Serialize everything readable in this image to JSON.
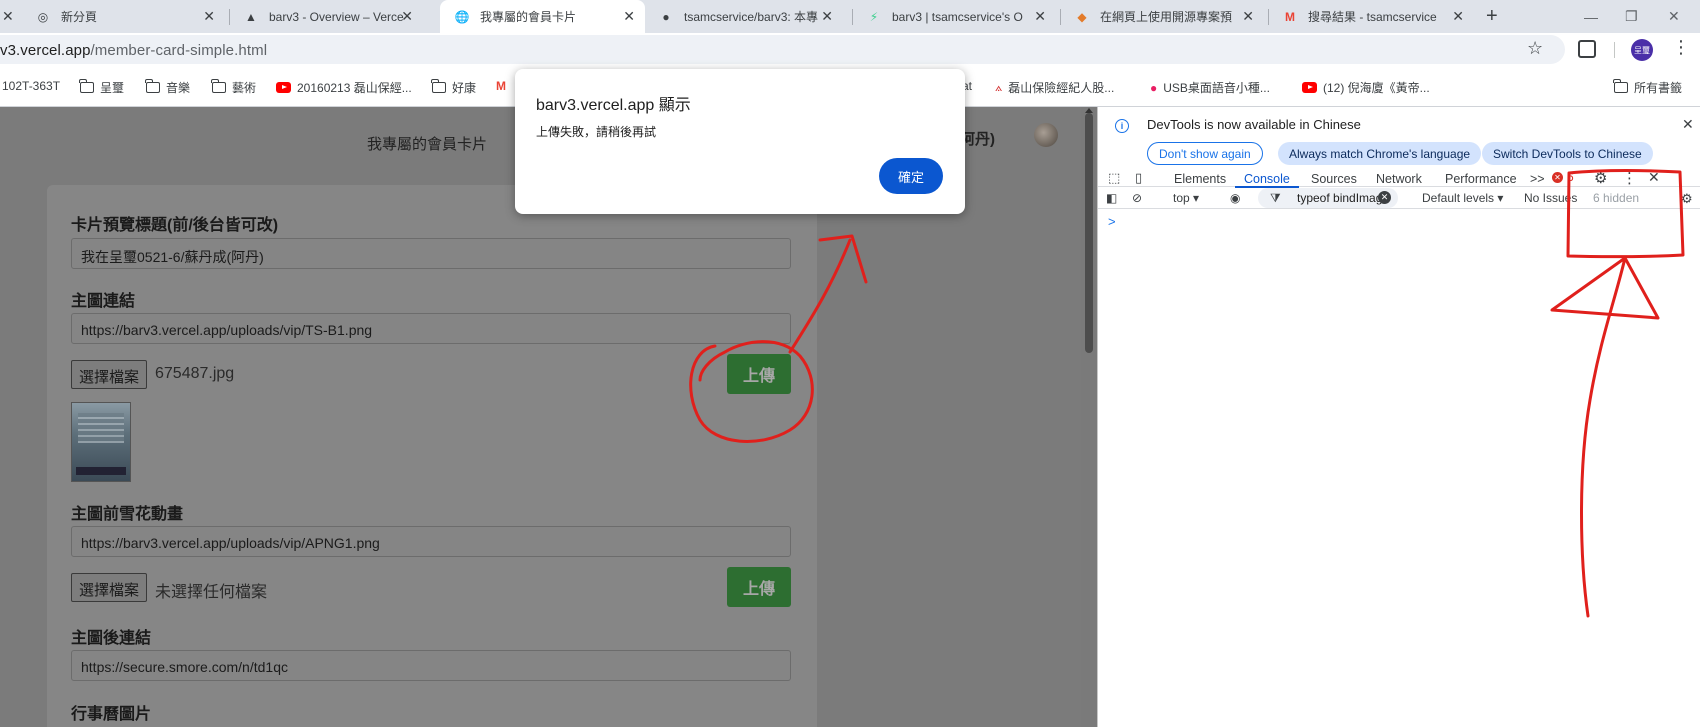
{
  "browser": {
    "tabs": [
      {
        "title": "新分頁",
        "icon": "chrome-icon"
      },
      {
        "title": "barv3 - Overview – Verce",
        "icon": "vercel-icon"
      },
      {
        "title": "我專屬的會員卡片",
        "icon": "globe-icon"
      },
      {
        "title": "tsamcservice/barv3: 本專",
        "icon": "github-icon"
      },
      {
        "title": "barv3 | tsamcservice's O",
        "icon": "supabase-icon"
      },
      {
        "title": "在網頁上使用開源專案預",
        "icon": "fox-icon"
      },
      {
        "title": "搜尋結果 - tsamcservice",
        "icon": "gmail-icon"
      }
    ],
    "new_tab": "+",
    "url_prefix": "v3.vercel.app",
    "url_path": "/member-card-simple.html",
    "profile_label": "呈璽",
    "bookmarks": [
      {
        "label": "102T-363T",
        "icon": "none"
      },
      {
        "label": "呈璽",
        "icon": "folder-icon"
      },
      {
        "label": "音樂",
        "icon": "folder-icon"
      },
      {
        "label": "藝術",
        "icon": "folder-icon"
      },
      {
        "label": "20160213 磊山保經...",
        "icon": "youtube-icon"
      },
      {
        "label": "好康",
        "icon": "folder-icon"
      },
      {
        "label": "at",
        "icon": "none"
      },
      {
        "label": "磊山保險經紀人股...",
        "icon": "leishan-icon"
      },
      {
        "label": "USB桌面語音小種...",
        "icon": "app-icon"
      },
      {
        "label": "(12) 倪海廈《黃帝...",
        "icon": "youtube-icon"
      },
      {
        "label": "所有書籤",
        "icon": "folder-icon"
      }
    ]
  },
  "page": {
    "title": "我專屬的會員卡片",
    "user_name": "成(阿丹)",
    "fields": {
      "preview_title_label": "卡片預覽標題(前/後台皆可改)",
      "preview_title_value": "我在呈璽0521-6/蘇丹成(阿丹)",
      "main_image_label": "主圖連結",
      "main_image_value": "https://barv3.vercel.app/uploads/vip/TS-B1.png",
      "main_file_button": "選擇檔案",
      "main_file_name": "675487.jpg",
      "upload_button": "上傳",
      "snow_label": "主圖前雪花動畫",
      "snow_value": "https://barv3.vercel.app/uploads/vip/APNG1.png",
      "snow_file_button": "選擇檔案",
      "snow_file_name": "未選擇任何檔案",
      "after_link_label": "主圖後連結",
      "after_link_value": "https://secure.smore.com/n/td1qc",
      "calendar_label": "行事曆圖片"
    }
  },
  "dialog": {
    "title": "barv3.vercel.app 顯示",
    "message": "上傳失敗，請稍後再試",
    "ok": "確定"
  },
  "devtools": {
    "banner": "DevTools is now available in Chinese",
    "btn_dont_show": "Don't show again",
    "btn_match": "Always match Chrome's language",
    "btn_switch": "Switch DevTools to Chinese",
    "tabs": [
      "Elements",
      "Console",
      "Sources",
      "Network",
      "Performance"
    ],
    "active_tab": "Console",
    "more_tabs": ">>",
    "error_count": "6",
    "context": "top ▾",
    "filter": "typeof bindImag",
    "levels": "Default levels ▾",
    "issues": "No Issues",
    "hidden": "6 hidden",
    "prompt": ">"
  },
  "annotation_color": "#e0201c"
}
